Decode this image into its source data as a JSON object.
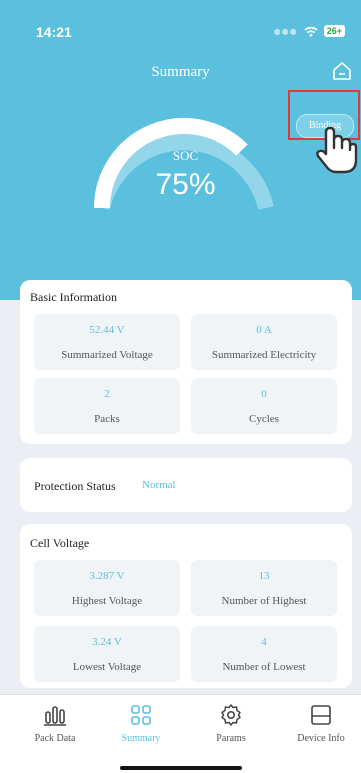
{
  "status_bar": {
    "time": "14:21",
    "battery": "26+"
  },
  "header": {
    "title": "Summary",
    "binding_label": "Binding"
  },
  "soc": {
    "label": "SOC",
    "value": "75%",
    "level_percent": 75
  },
  "basic_info": {
    "title": "Basic Information",
    "tiles": [
      {
        "value": "52.44 V",
        "label": "Summarized Voltage"
      },
      {
        "value": "0 A",
        "label": "Summarized Electricity"
      },
      {
        "value": "2",
        "label": "Packs"
      },
      {
        "value": "0",
        "label": "Cycles"
      }
    ]
  },
  "protection": {
    "label": "Protection Status",
    "value": "Normal"
  },
  "cell_voltage": {
    "title": "Cell Voltage",
    "tiles": [
      {
        "value": "3.287 V",
        "label": "Highest Voltage"
      },
      {
        "value": "13",
        "label": "Number of Highest"
      },
      {
        "value": "3.24 V",
        "label": "Lowest Voltage"
      },
      {
        "value": "4",
        "label": "Number of Lowest"
      }
    ]
  },
  "tabs": [
    {
      "label": "Pack Data",
      "icon": "bar-chart-icon"
    },
    {
      "label": "Summary",
      "icon": "grid-icon",
      "active": true
    },
    {
      "label": "Params",
      "icon": "gear-icon"
    },
    {
      "label": "Device Info",
      "icon": "device-icon"
    }
  ],
  "colors": {
    "accent": "#5bc0de",
    "highlight": "#e03b3b"
  }
}
